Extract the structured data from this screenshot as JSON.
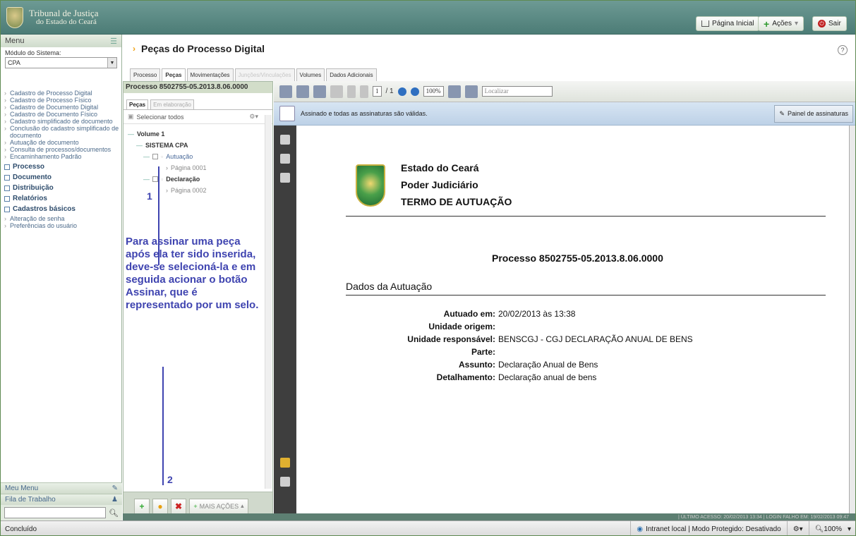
{
  "header": {
    "logo_line1": "Tribunal de Justiça",
    "logo_line2": "do Estado do Ceará",
    "btn_home": "Página Inicial",
    "btn_actions": "Ações",
    "btn_exit": "Sair"
  },
  "sidebar": {
    "menu_label": "Menu",
    "module_label": "Módulo do Sistema:",
    "module_value": "CPA",
    "links": [
      "Cadastro de Processo Digital",
      "Cadastro de Processo Físico",
      "Cadastro de Documento Digital",
      "Cadastro de Documento Físico",
      "Cadastro simplificado de documento",
      "Conclusão do cadastro simplificado de documento",
      "Autuação de documento",
      "Consulta de processos/documentos",
      "Encaminhamento Padrão"
    ],
    "groups": [
      "Processo",
      "Documento",
      "Distribuição",
      "Relatórios",
      "Cadastros básicos"
    ],
    "group_links": [
      "Alteração de senha",
      "Preferências do usuário"
    ],
    "my_menu": "Meu Menu",
    "work_queue": "Fila de Trabalho"
  },
  "page": {
    "title": "Peças do Processo Digital",
    "help": "?"
  },
  "tabs": [
    "Processo",
    "Peças",
    "Movimentações",
    "Junções/Vinculações",
    "Volumes",
    "Dados Adicionais"
  ],
  "left_pane": {
    "process": "Processo 8502755-05.2013.8.06.0000",
    "tab_pecas": "Peças",
    "tab_elab": "Em elaboração",
    "select_all": "Selecionar todos",
    "tree": {
      "volume": "Volume 1",
      "system": "SISTEMA CPA",
      "doc1": "Autuação",
      "doc1_page": "Página 0001",
      "doc2": "Declaração",
      "doc2_page": "Página 0002"
    },
    "annotation": "Para assinar uma peça após ela ter sido inserida, deve-se selecioná-la e em seguida acionar o botão Assinar, que é representado por um selo.",
    "marker1": "1",
    "marker2": "2",
    "more_actions": "MAIS AÇÕES"
  },
  "viewer": {
    "page_input": "1",
    "page_total": "/ 1",
    "zoom": "100%",
    "find": "Localizar",
    "sig_status": "Assinado e todas as assinaturas são válidas.",
    "sig_panel": "Painel de assinaturas",
    "doc": {
      "line1": "Estado do Ceará",
      "line2": "Poder Judiciário",
      "line3": "TERMO DE AUTUAÇÃO",
      "process": "Processo 8502755-05.2013.8.06.0000",
      "section": "Dados da Autuação",
      "fields": [
        {
          "k": "Autuado em:",
          "v": "20/02/2013 às 13:38"
        },
        {
          "k": "Unidade origem:",
          "v": ""
        },
        {
          "k": "Unidade responsável:",
          "v": "BENSCGJ - CGJ DECLARAÇÃO ANUAL DE BENS"
        },
        {
          "k": "Parte:",
          "v": ""
        },
        {
          "k": "Assunto:",
          "v": "Declaração Anual de Bens"
        },
        {
          "k": "Detalhamento:",
          "v": "Declaração anual de bens"
        }
      ]
    }
  },
  "access_bar": "|  ÚLTIMO ACESSO: 20/02/2013 13:34  |  LOGIN FALHO EM: 19/02/2013 09:47",
  "status": {
    "left": "Concluído",
    "zone": "Intranet local | Modo Protegido: Desativado",
    "zoom": "100%"
  }
}
